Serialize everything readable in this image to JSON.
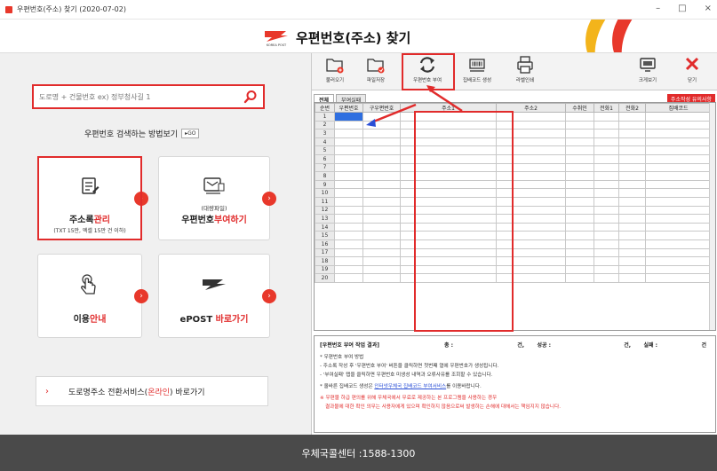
{
  "window": {
    "title": "우편번호(주소) 찾기 (2020-07-02)",
    "minimize": "–",
    "maximize": "□",
    "close": "×"
  },
  "header": {
    "title": "우편번호(주소) 찾기",
    "logo_text": "KOREA POST"
  },
  "left": {
    "search_placeholder": "도로명 + 건물번호 ex) 정부청사길 1",
    "howto_label": "우편번호 검색하는 방법보기",
    "howto_go": "▸GO",
    "tiles": [
      {
        "title_a": "주소록",
        "title_b": "관리",
        "sub": "(TXT 15만, 엑셀 15만 건 이하)"
      },
      {
        "small": "(대량파일)",
        "title_a": "우편번호",
        "title_b": "부여하기"
      },
      {
        "title_a": "이용",
        "title_b": "안내"
      },
      {
        "title_a": "ePOST ",
        "title_b": "바로가기"
      }
    ],
    "road_link": {
      "prefix": "도로명주소 전환서비스(",
      "highlight": "온라인",
      "suffix": ") 바로가기"
    }
  },
  "toolbar": {
    "buttons": [
      {
        "label": "불러오기"
      },
      {
        "label": "파일저장"
      },
      {
        "label": "우편번호 부여"
      },
      {
        "label": "집배코드 생성"
      },
      {
        "label": "라벨인쇄"
      },
      {
        "label": "크게보기"
      },
      {
        "label": "닫기"
      }
    ]
  },
  "tabs": [
    {
      "label": "전체"
    },
    {
      "label": "부여실패"
    }
  ],
  "notice_button": "주소작성 유의사항",
  "grid": {
    "columns": [
      "순번",
      "우편번호",
      "구우편번호",
      "주소1",
      "주소2",
      "수취인",
      "전화1",
      "전화2",
      "집배코드"
    ],
    "rows": [
      "1",
      "2",
      "3",
      "4",
      "5",
      "6",
      "7",
      "8",
      "9",
      "10",
      "11",
      "12",
      "13",
      "14",
      "15",
      "16",
      "17",
      "18",
      "19",
      "20"
    ]
  },
  "result": {
    "title": "[우편번호 부여 작업 결과]",
    "total_label": "총 :",
    "count_unit": "건,",
    "success_label": "성공 :",
    "count_unit2": "건,",
    "fail_label": "실패 :",
    "count_unit3": "건",
    "method_title": "* 우편번호 부여 방법",
    "method_1": "- 주소록 작성 후 '우편번호 부여' 버튼을 클릭하면 첫번째 열에 우편번호가 생성됩니다.",
    "method_2": "- '부여실패' 탭을 클릭하면 우편번호 미생성 내역과 오류사유를 조회할 수 있습니다.",
    "barcode_prefix": "* 올바른 집배코드 생성은 ",
    "barcode_link": "인터넷우체국 집배코드 부여서비스",
    "barcode_suffix": "를 이용바랍니다.",
    "warn_1": "※ 우편물 하급 편의를 위해 우체국에서 무료로 제공하는 본 프로그램을 사용하는 경우",
    "warn_2": "결과물에 대한 확인 의무는 사용자에게 있으며 확인하지 않음으로써 발생하는 손해에 대해서는 책임지지 않습니다."
  },
  "footer": {
    "text": "우체국콜센터 :1588-1300"
  },
  "colors": {
    "accent_red": "#e12b2b",
    "brand_yellow": "#f3b41b",
    "footer_bg": "#4a4a4a",
    "link_blue": "#2a4fd6"
  }
}
